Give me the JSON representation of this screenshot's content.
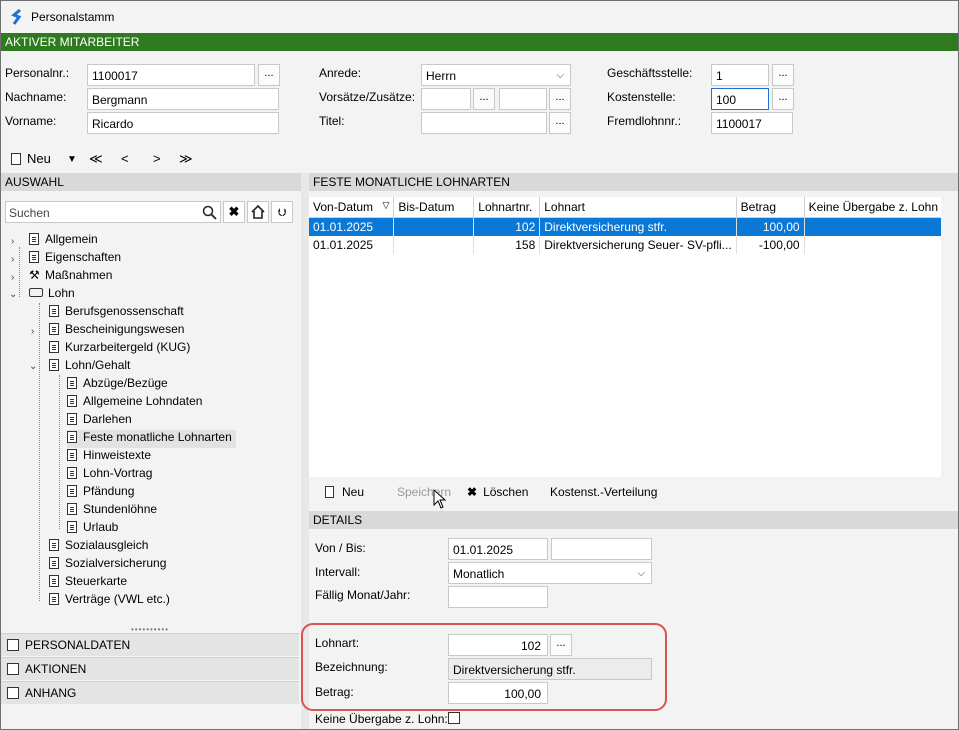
{
  "window": {
    "title": "Personalstamm"
  },
  "active_section": "AKTIVER MITARBEITER",
  "employee": {
    "personalnr_label": "Personalnr.:",
    "personalnr": "1100017",
    "nachname_label": "Nachname:",
    "nachname": "Bergmann",
    "vorname_label": "Vorname:",
    "vorname": "Ricardo",
    "anrede_label": "Anrede:",
    "anrede": "Herrn",
    "vorsaetze_label": "Vorsätze/Zusätze:",
    "vorsaetze": "",
    "zusaetze": "",
    "titel_label": "Titel:",
    "titel": "",
    "geschaeftsstelle_label": "Geschäftsstelle:",
    "geschaeftsstelle": "1",
    "kostenstelle_label": "Kostenstelle:",
    "kostenstelle": "100",
    "fremdlohnnr_label": "Fremdlohnnr.:",
    "fremdlohnnr": "1100017",
    "dots": "..."
  },
  "toolbar": {
    "new_label": "Neu",
    "first": "≪",
    "prev": "<",
    "next": ">",
    "last": "≫"
  },
  "auswahl": {
    "header": "AUSWAHL",
    "search_placeholder": "Suchen",
    "tree": [
      "Allgemein",
      "Eigenschaften",
      "Maßnahmen",
      "Lohn",
      "Berufsgenossenschaft",
      "Bescheinigungswesen",
      "Kurzarbeitergeld (KUG)",
      "Lohn/Gehalt",
      "Abzüge/Bezüge",
      "Allgemeine Lohndaten",
      "Darlehen",
      "Feste monatliche Lohnarten",
      "Hinweistexte",
      "Lohn-Vortrag",
      "Pfändung",
      "Stundenlöhne",
      "Urlaub",
      "Sozialausgleich",
      "Sozialversicherung",
      "Steuerkarte",
      "Verträge (VWL etc.)"
    ],
    "selected": "Feste monatliche Lohnarten"
  },
  "accordion": [
    "PERSONALDATEN",
    "AKTIONEN",
    "ANHANG"
  ],
  "lohnarten": {
    "header": "FESTE MONATLICHE LOHNARTEN",
    "columns": [
      "Von-Datum",
      "Bis-Datum",
      "Lohnartnr.",
      "Lohnart",
      "Betrag",
      "Keine Übergabe z. Lohn"
    ],
    "rows": [
      [
        "01.01.2025",
        "",
        "102",
        "Direktversicherung stfr.",
        "100,00",
        ""
      ],
      [
        "01.01.2025",
        "",
        "158",
        "Direktversicherung Seuer- SV-pfli...",
        "-100,00",
        ""
      ]
    ]
  },
  "actions": {
    "new": "Neu",
    "save": "Speichern",
    "delete": "Löschen",
    "cost": "Kostenst.-Verteilung"
  },
  "details": {
    "header": "DETAILS",
    "von_bis_label": "Von / Bis:",
    "von": "01.01.2025",
    "bis": "",
    "intervall_label": "Intervall:",
    "intervall": "Monatlich",
    "faellig_label": "Fällig Monat/Jahr:",
    "faellig": "",
    "lohnart_label": "Lohnart:",
    "lohnart": "102",
    "bezeichnung_label": "Bezeichnung:",
    "bezeichnung": "Direktversicherung stfr.",
    "betrag_label": "Betrag:",
    "betrag": "100,00",
    "keine_uebergabe_label": "Keine Übergabe z. Lohn:"
  },
  "colors": {
    "accent_green": "#2f7a1f",
    "selection_blue": "#0a78d7",
    "highlight_red": "#d9534f"
  }
}
